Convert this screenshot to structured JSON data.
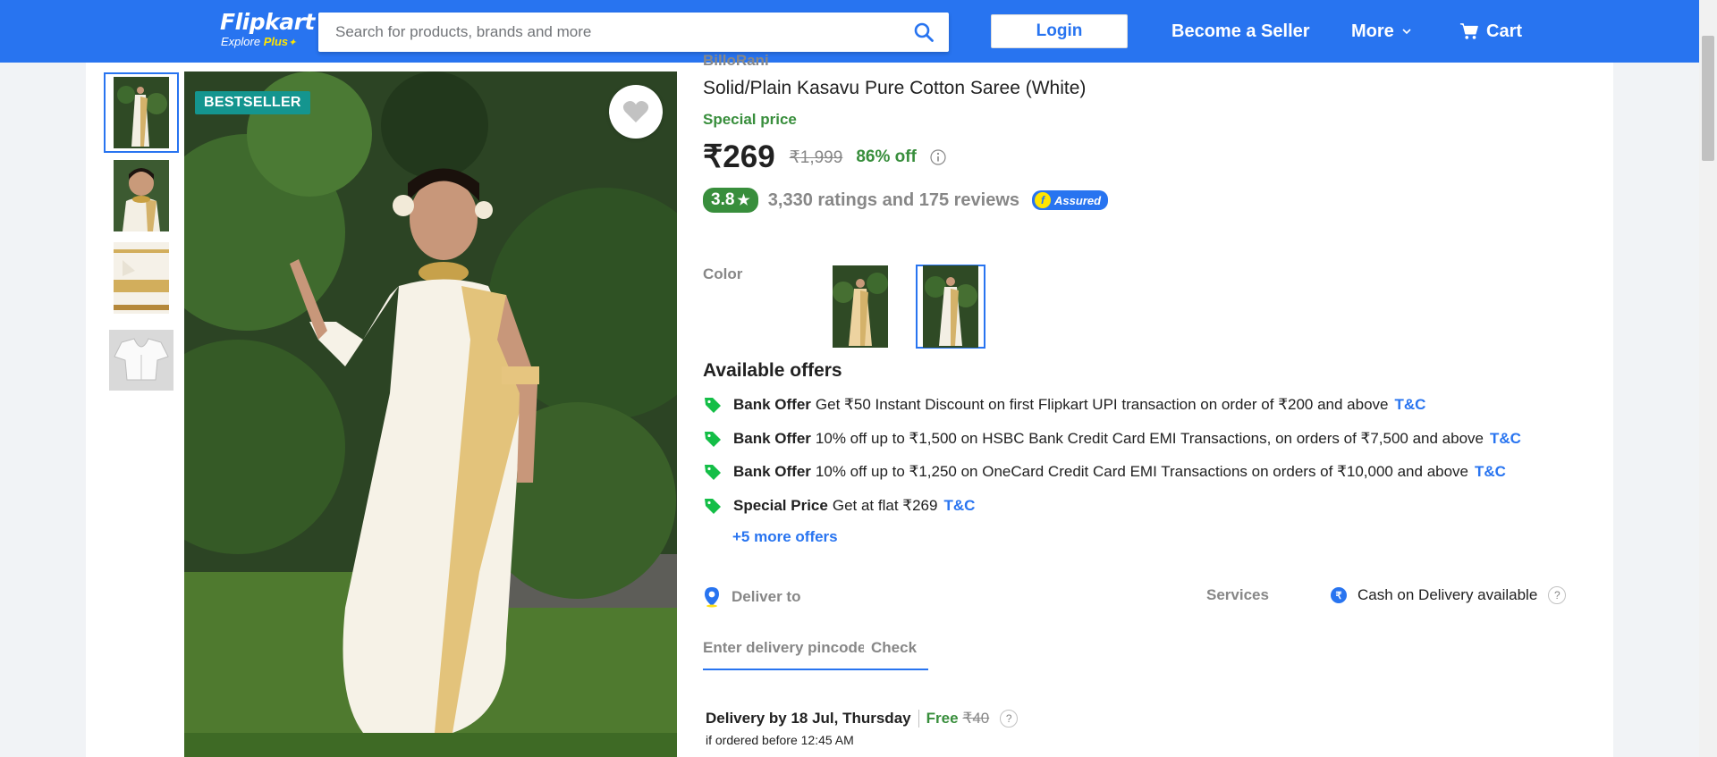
{
  "header": {
    "logo": "Flipkart",
    "logo_sub_prefix": "Explore",
    "logo_sub_plus": "Plus",
    "search_placeholder": "Search for products, brands and more",
    "login_label": "Login",
    "seller_label": "Become a Seller",
    "more_label": "More",
    "cart_label": "Cart",
    "brand_color": "#2874f0"
  },
  "gallery": {
    "thumbnails": [
      "saree-front-thumb",
      "saree-closeup-thumb",
      "saree-fabric-thumb",
      "blouse-thumb"
    ],
    "badge": "BESTSELLER"
  },
  "product": {
    "brand": "BilloRani",
    "title": "Solid/Plain Kasavu Pure Cotton Saree  (White)",
    "special_price_label": "Special price",
    "price": "₹269",
    "mrp": "₹1,999",
    "discount": "86% off",
    "rating": "3.8",
    "rating_text": "3,330 ratings and 175 reviews",
    "assured_label": "Assured"
  },
  "color": {
    "label": "Color",
    "options": [
      "beige",
      "white"
    ],
    "selected": "white"
  },
  "offers": {
    "title": "Available offers",
    "items": [
      {
        "type": "Bank Offer",
        "text": "Get ₹50 Instant Discount on first Flipkart UPI transaction on order of ₹200 and above",
        "tnc": "T&C"
      },
      {
        "type": "Bank Offer",
        "text": "10% off up to ₹1,500 on HSBC Bank Credit Card EMI Transactions, on orders of ₹7,500 and above",
        "tnc": "T&C"
      },
      {
        "type": "Bank Offer",
        "text": "10% off up to ₹1,250 on OneCard Credit Card EMI Transactions on orders of ₹10,000 and above",
        "tnc": "T&C"
      },
      {
        "type": "Special Price",
        "text": "Get at flat ₹269",
        "tnc": "T&C"
      }
    ],
    "more": "+5 more offers"
  },
  "delivery": {
    "label": "Deliver to",
    "pincode_placeholder": "Enter delivery pincode",
    "check_label": "Check",
    "delivery_by": "Delivery by 18 Jul, Thursday",
    "free_label": "Free",
    "fee": "₹40",
    "cutoff": "if ordered before 12:45 AM"
  },
  "services": {
    "label": "Services",
    "cod": "Cash on Delivery available"
  }
}
